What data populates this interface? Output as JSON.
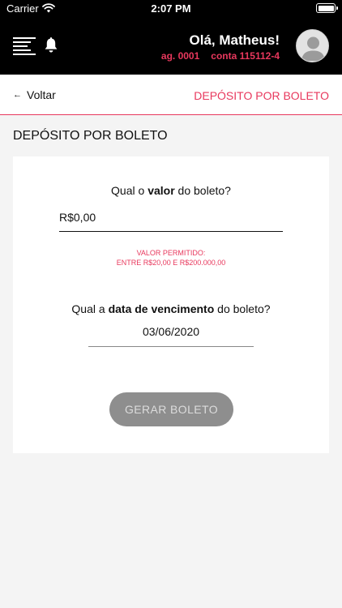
{
  "status_bar": {
    "carrier": "Carrier",
    "time": "2:07 PM"
  },
  "header": {
    "greeting": "Olá, Matheus!",
    "agency": "ag. 0001",
    "account": "conta 115112-4",
    "icons": {
      "menu": "menu-icon",
      "notifications": "bell-icon",
      "avatar": "user-avatar"
    },
    "accent_color": "#e8385d"
  },
  "nav": {
    "back_label": "Voltar",
    "back_icon": "arrow-left-icon",
    "title": "DEPÓSITO POR BOLETO"
  },
  "page": {
    "title": "DEPÓSITO POR BOLETO"
  },
  "form": {
    "value_question": {
      "prefix": "Qual o ",
      "bold": "valor",
      "suffix": " do boleto?"
    },
    "value_input": "R$0,00",
    "allowed_line1": "VALOR PERMITIDO:",
    "allowed_line2": "ENTRE R$20,00 E R$200.000,00",
    "date_question": {
      "prefix": "Qual a ",
      "bold": "data de vencimento",
      "suffix": " do boleto?"
    },
    "date_input": "03/06/2020",
    "submit_label": "GERAR BOLETO"
  }
}
